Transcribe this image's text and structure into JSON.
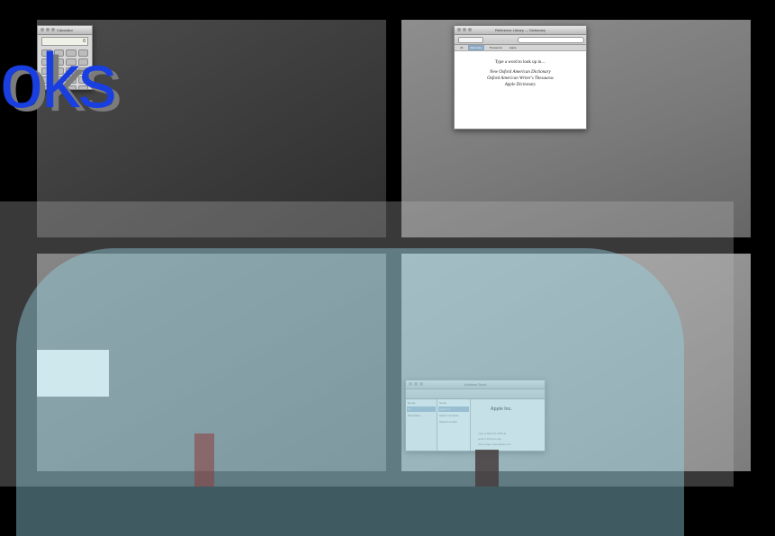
{
  "overlay": {
    "text": "oks"
  },
  "spaces": {
    "top_left": {
      "calculator": {
        "title": "Calculator",
        "display": "0",
        "key_count": 20
      }
    },
    "top_right": {
      "dictionary": {
        "title": "Reference Library — Dictionary",
        "tabs": [
          "All",
          "Dictionary",
          "Thesaurus",
          "Apple"
        ],
        "active_tab": "Dictionary",
        "prompt": "Type a word to look up in…",
        "sources": [
          "New Oxford American Dictionary",
          "Oxford American Writer's Thesaurus",
          "Apple Dictionary"
        ]
      }
    },
    "bottom_left": {},
    "bottom_right": {
      "address_book": {
        "title": "Address Book",
        "group_header": "Group",
        "group_selected": "All",
        "group_items": [
          "Directories"
        ],
        "name_header": "Name",
        "names": [
          "Apple Inc.",
          "Apple Computer",
          "Absent contact"
        ],
        "card_name": "Apple Inc.",
        "card_logo": "",
        "card_rows": [
          "main 1-800-MY-APPLE",
          "work 1 Infinite Loop",
          "home page www.apple.com"
        ]
      }
    }
  },
  "colors": {
    "overlay_text": "#1a3fe0",
    "background": "#000000",
    "veil_tint": "#96d7e6"
  }
}
